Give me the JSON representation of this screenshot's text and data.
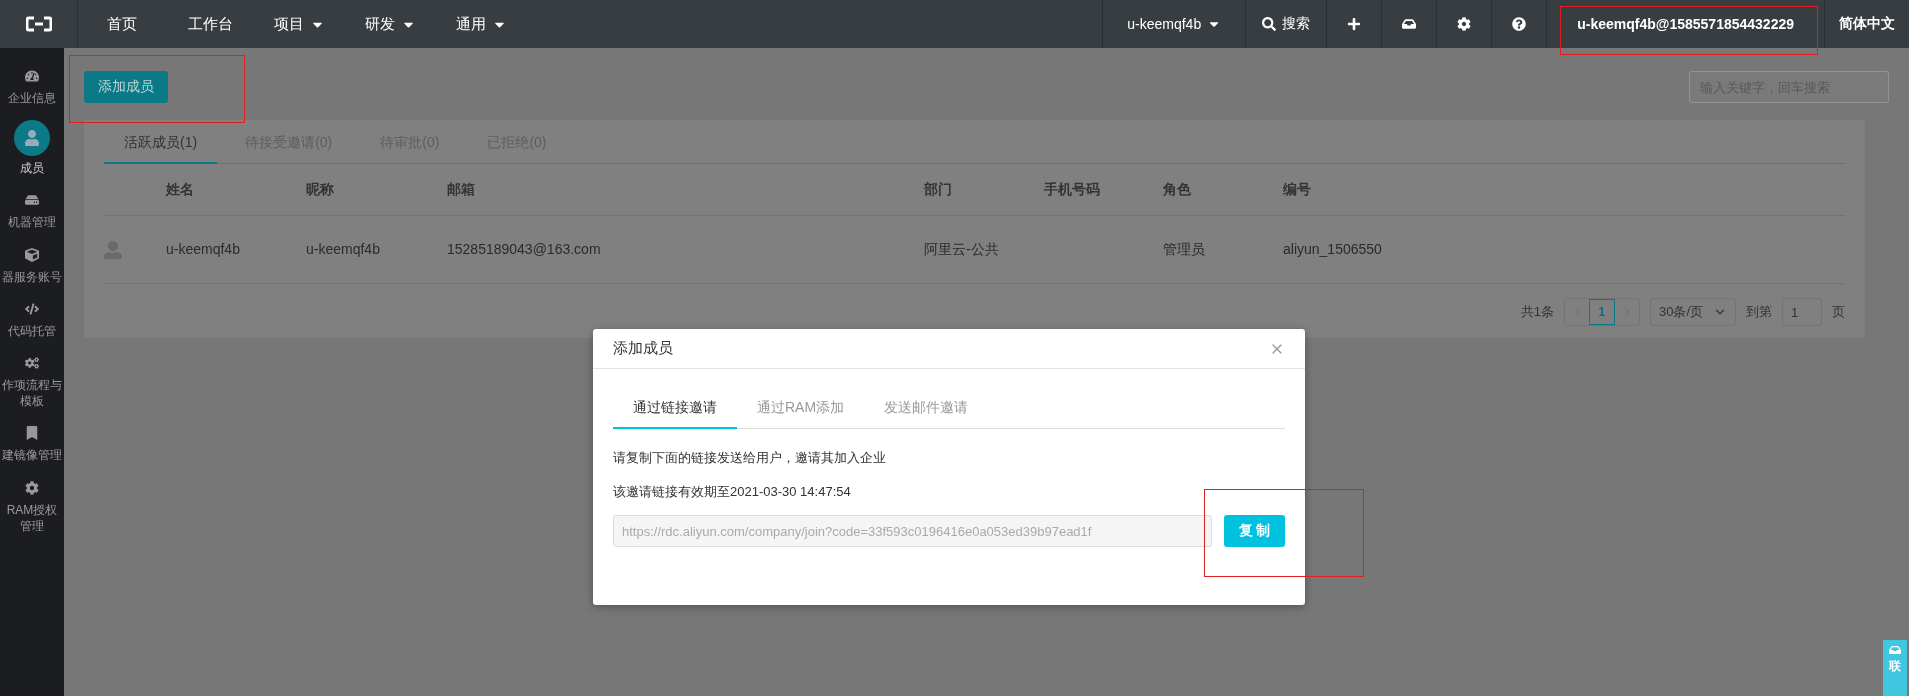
{
  "topbar": {
    "nav": [
      {
        "label": "首页",
        "dropdown": false
      },
      {
        "label": "工作台",
        "dropdown": false
      },
      {
        "label": "项目",
        "dropdown": true
      },
      {
        "label": "研发",
        "dropdown": true
      },
      {
        "label": "通用",
        "dropdown": true
      }
    ],
    "account": {
      "label": "u-keemqf4b",
      "dropdown": true
    },
    "search": {
      "label": "搜索"
    },
    "user": "u-keemqf4b@1585571854432229",
    "language": "简体中文"
  },
  "sidebar": {
    "items": [
      {
        "label": "企业信息",
        "selected": false
      },
      {
        "label": "成员",
        "selected": true
      },
      {
        "label": "机器管理",
        "selected": false
      },
      {
        "label": "器服务账号",
        "selected": false
      },
      {
        "label": "代码托管",
        "selected": false
      },
      {
        "label": "作项流程与模板",
        "selected": false
      },
      {
        "label": "建镜像管理",
        "selected": false
      },
      {
        "label": "RAM授权管理",
        "selected": false
      }
    ]
  },
  "toolbar": {
    "add_button": "添加成员",
    "search": {
      "placeholder": "输入关键字，回车搜索"
    }
  },
  "members": {
    "tabs": [
      {
        "label": "活跃成员(1)",
        "selected": true
      },
      {
        "label": "待接受邀请(0)",
        "selected": false
      },
      {
        "label": "待审批(0)",
        "selected": false
      },
      {
        "label": "已拒绝(0)",
        "selected": false
      }
    ],
    "table": {
      "columns": [
        "姓名",
        "昵称",
        "邮箱",
        "部门",
        "手机号码",
        "角色",
        "编号"
      ],
      "rows": [
        {
          "cells": [
            "u-keemqf4b",
            "u-keemqf4b",
            "15285189043@163.com",
            "阿里云-公共",
            "",
            "管理员",
            "aliyun_1506550"
          ]
        }
      ]
    },
    "pagination": {
      "total": "共1条",
      "pages": [
        {
          "label": "1",
          "selected": true
        }
      ],
      "page_size": "30条/页",
      "goto_label": "到第",
      "goto_value": "1",
      "page_unit": "页"
    }
  },
  "dialog": {
    "title": "添加成员",
    "tabs": [
      {
        "label": "通过链接邀请",
        "selected": true
      },
      {
        "label": "通过RAM添加",
        "selected": false
      },
      {
        "label": "发送邮件邀请",
        "selected": false
      }
    ],
    "instruction": "请复制下面的链接发送给用户，邀请其加入企业",
    "expiry": "该邀请链接有效期至2021-03-30 14:47:54",
    "link": "https://rdc.aliyun.com/company/join?code=33f593c0196416e0a053ed39b97ead1f",
    "copy_button": "复 制"
  },
  "contact_widget": {
    "label": "联"
  }
}
